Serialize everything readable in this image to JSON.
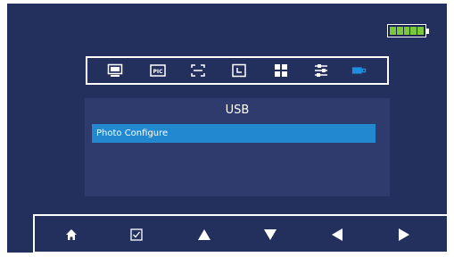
{
  "battery": {
    "icon": "battery-full-icon",
    "level": 1.0,
    "color": "#7cc63a"
  },
  "toolbar": {
    "items": [
      {
        "icon": "monitor-icon"
      },
      {
        "icon": "pic-icon",
        "label": "PIC"
      },
      {
        "icon": "scan-frame-icon"
      },
      {
        "icon": "clock-icon"
      },
      {
        "icon": "grid-icon"
      },
      {
        "icon": "settings-sliders-icon"
      },
      {
        "icon": "usb-icon",
        "active": true
      }
    ]
  },
  "usb_panel": {
    "title": "USB",
    "items": [
      {
        "label": "Photo Configure",
        "selected": true
      }
    ]
  },
  "navbar": {
    "buttons": [
      {
        "icon": "home-icon"
      },
      {
        "icon": "checkbox-icon"
      },
      {
        "icon": "arrow-up-icon"
      },
      {
        "icon": "arrow-down-icon"
      },
      {
        "icon": "arrow-left-icon"
      },
      {
        "icon": "arrow-right-icon"
      }
    ]
  },
  "colors": {
    "background": "#23305e",
    "panel": "#2e3b6c",
    "highlight": "#2288cf",
    "accent_usb": "#1e8fe0"
  }
}
